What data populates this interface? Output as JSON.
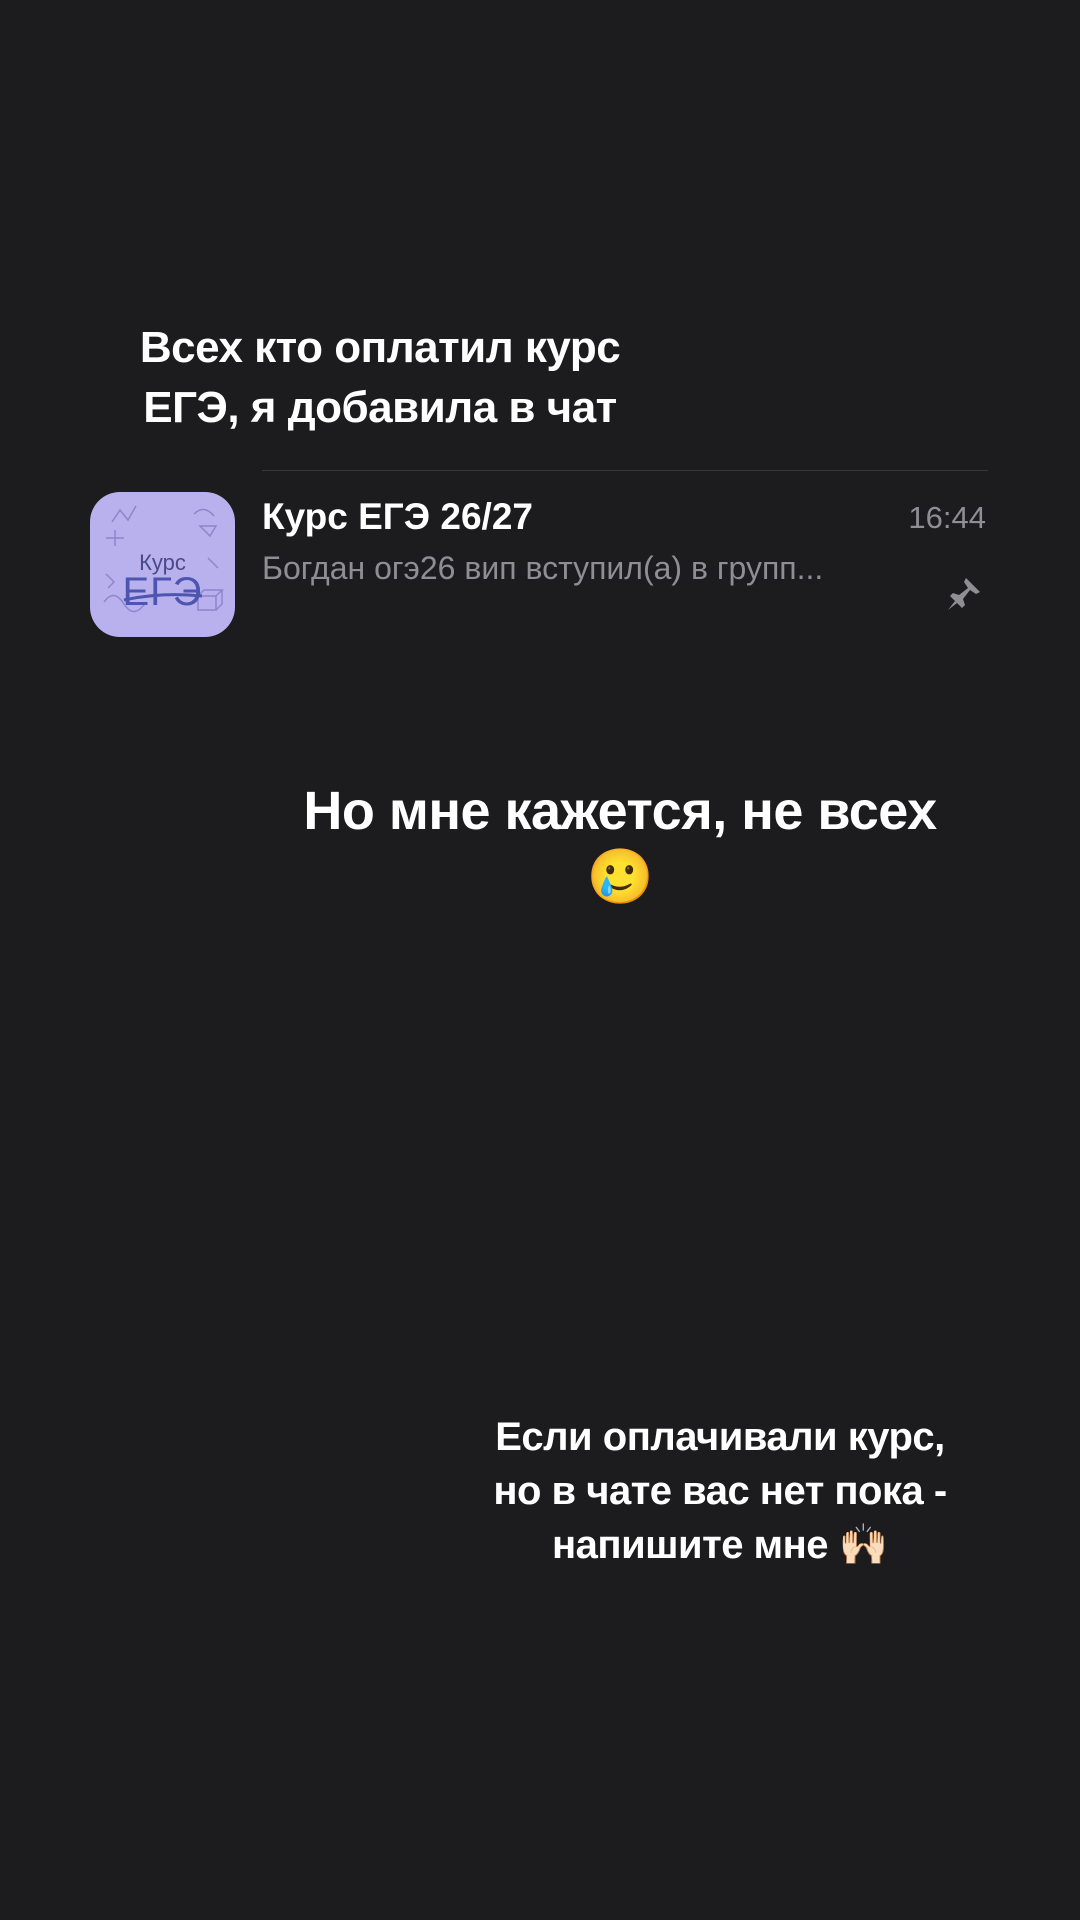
{
  "story": {
    "caption_top": [
      "Всех кто оплатил курс",
      "ЕГЭ, я добавила в чат"
    ],
    "caption_middle": [
      "Но мне кажется, не всех",
      "🥲"
    ],
    "caption_bottom": [
      "Если оплачивали курс,",
      "но в чате вас нет пока -",
      "напишите мне 🙌🏻"
    ]
  },
  "chat": {
    "avatar_small_text": "Курс",
    "avatar_big_text": "ЕГЭ",
    "title": "Курс ЕГЭ 26/27",
    "time": "16:44",
    "preview": "Богдан огэ26 вип вступил(а) в групп...",
    "pinned_icon": "pin-icon",
    "avatar_color": "#b8b1ee"
  },
  "colors": {
    "background": "#1c1c1e",
    "secondary_text": "#8e8e93",
    "accent": "#4d55b0"
  }
}
